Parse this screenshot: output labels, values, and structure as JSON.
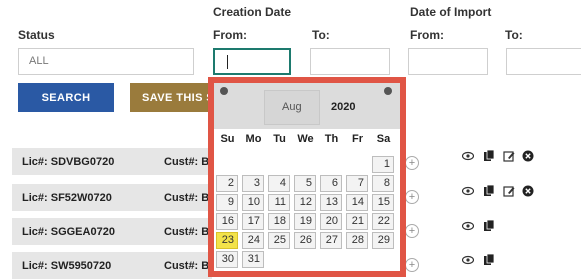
{
  "filters": {
    "status_label": "Status",
    "status_value": "ALL",
    "creation_date_label": "Creation Date",
    "date_of_import_label": "Date of Import",
    "from_label": "From:",
    "to_label": "To:",
    "import_from_label": "From:",
    "import_to_label": "To:"
  },
  "buttons": {
    "search": "SEARCH",
    "save": "SAVE THIS SE"
  },
  "rows": [
    {
      "lic": "Lic#: SDVBG0720",
      "cust": "Cust#: B"
    },
    {
      "lic": "Lic#: SF52W0720",
      "cust": "Cust#: B"
    },
    {
      "lic": "Lic#: SGGEA0720",
      "cust": "Cust#: B"
    },
    {
      "lic": "Lic#: SW5950720",
      "cust": "Cust#: B"
    }
  ],
  "datepicker": {
    "month": "Aug",
    "year": "2020",
    "weekdays": [
      "Su",
      "Mo",
      "Tu",
      "We",
      "Th",
      "Fr",
      "Sa"
    ],
    "weeks": [
      [
        "",
        "",
        "",
        "",
        "",
        "",
        "1"
      ],
      [
        "2",
        "3",
        "4",
        "5",
        "6",
        "7",
        "8"
      ],
      [
        "9",
        "10",
        "11",
        "12",
        "13",
        "14",
        "15"
      ],
      [
        "16",
        "17",
        "18",
        "19",
        "20",
        "21",
        "22"
      ],
      [
        "23",
        "24",
        "25",
        "26",
        "27",
        "28",
        "29"
      ],
      [
        "30",
        "31",
        "",
        "",
        "",
        "",
        ""
      ]
    ],
    "today": "23"
  },
  "colors": {
    "search_button": "#2a59a4",
    "save_button": "#9a7b3c",
    "datepicker_border": "#e05545",
    "today_highlight": "#f3e34a"
  }
}
